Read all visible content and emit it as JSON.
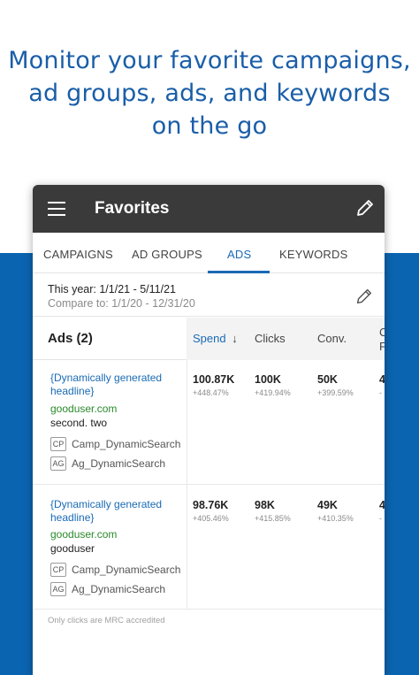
{
  "promo": {
    "line1": "Monitor your favorite campaigns,",
    "line2": "ad groups, ads, and keywords",
    "line3": "on the go"
  },
  "appbar": {
    "title": "Favorites"
  },
  "tabs": [
    {
      "label": "CAMPAIGNS",
      "active": false
    },
    {
      "label": "AD GROUPS",
      "active": false
    },
    {
      "label": "ADS",
      "active": true
    },
    {
      "label": "KEYWORDS",
      "active": false
    }
  ],
  "dates": {
    "this_year": "This year: 1/1/21 - 5/11/21",
    "compare": "Compare to: 1/1/20 - 12/31/20"
  },
  "table": {
    "title": "Ads (2)",
    "columns": [
      "Spend",
      "Clicks",
      "Conv.",
      "C",
      "F"
    ],
    "sort_arrow": "↓",
    "rows": [
      {
        "headline_1": "{Dynamically generated",
        "headline_2": "headline}",
        "url": "gooduser.com",
        "desc": "second. two",
        "campaign_badge": "CP",
        "campaign": "Camp_DynamicSearch",
        "adgroup_badge": "AG",
        "adgroup": "Ag_DynamicSearch",
        "spend": "100.87K",
        "spend_delta": "+448.47%",
        "clicks": "100K",
        "clicks_delta": "+419.94%",
        "conv": "50K",
        "conv_delta": "+399.59%",
        "extra": "4",
        "extra_delta": "-"
      },
      {
        "headline_1": "{Dynamically generated",
        "headline_2": "headline}",
        "url": "gooduser.com",
        "desc": "gooduser",
        "campaign_badge": "CP",
        "campaign": "Camp_DynamicSearch",
        "adgroup_badge": "AG",
        "adgroup": "Ag_DynamicSearch",
        "spend": "98.76K",
        "spend_delta": "+405.46%",
        "clicks": "98K",
        "clicks_delta": "+415.85%",
        "conv": "49K",
        "conv_delta": "+410.35%",
        "extra": "4",
        "extra_delta": "-"
      }
    ]
  },
  "footnote": "Only clicks are MRC accredited",
  "colors": {
    "brand_blue": "#0b64b0",
    "appbar": "#3a3a3a",
    "accent": "#1a6bb5",
    "url_green": "#2a8a2a"
  },
  "icons": {
    "menu": "hamburger-menu-icon",
    "edit": "pencil-icon"
  }
}
